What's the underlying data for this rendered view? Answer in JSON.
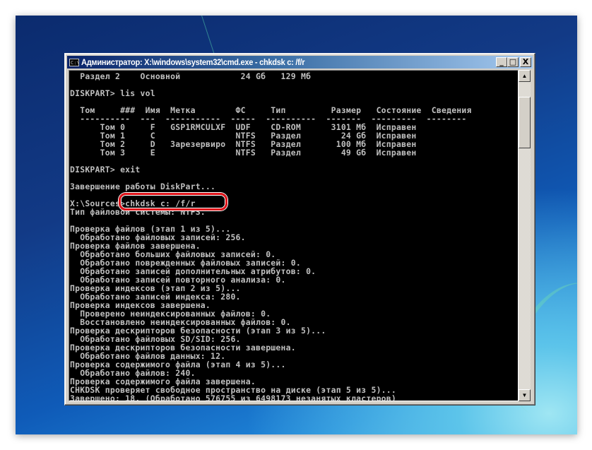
{
  "window": {
    "title": "Администратор: X:\\windows\\system32\\cmd.exe - chkdsk  c: /f/r",
    "icon": "cmd-icon",
    "icon_text": "C:\\.",
    "buttons": {
      "minimize": "_",
      "maximize": "□",
      "close": "X"
    }
  },
  "console": {
    "lines": [
      "  Раздел 2    Основной            24 Gб   129 Mб",
      "",
      "DISKPART> lis vol",
      "",
      "  Том     ###  Имя  Метка        ФС     Тип         Размер   Состояние  Сведения",
      "  ----------  ---  -----------  -----  ----------  -------  ---------  --------",
      "      Том 0     F   GSP1RMCULXF  UDF    CD-ROM      3101 Mб  Исправен",
      "      Том 1     C                NTFS   Раздел        24 Gб  Исправен",
      "      Том 2     D   Зарезервиро  NTFS   Раздел       100 Mб  Исправен",
      "      Том 3     E                NTFS   Раздел        49 Gб  Исправен",
      "",
      "DISKPART> exit",
      "",
      "Завершение работы DiskPart...",
      "",
      "X:\\Sources>chkdsk c: /f/r",
      "Тип файловой системы: NTFS.",
      "",
      "Проверка файлов (этап 1 из 5)...",
      "  Обработано файловых записей: 256.",
      "Проверка файлов завершена.",
      "  Обработано больших файловых записей: 0.",
      "  Обработано поврежденных файловых записей: 0.",
      "  Обработано записей дополнительных атрибутов: 0.",
      "  Обработано записей повторного анализа: 0.",
      "Проверка индексов (этап 2 из 5)...",
      "  Обработано записей индекса: 280.",
      "Проверка индексов завершена.",
      "  Проверено неиндексированных файлов: 0.",
      "  Восстановлено неиндексированных файлов: 0.",
      "Проверка дескрипторов безопасности (этап 3 из 5)...",
      "  Обработано файловых SD/SID: 256.",
      "Проверка дескрипторов безопасности завершена.",
      "  Обработано файлов данных: 12.",
      "Проверка содержимого файла (этап 4 из 5)...",
      "  Обработано файлов: 240.",
      "Проверка содержимого файла завершена.",
      "CHKDSK проверяет свободное пространство на диске (этап 5 из 5)...",
      "Завершено: 18. (Обработано 576755 из 6498173 незанятых кластеров)"
    ]
  },
  "scrollbar": {
    "up_arrow": "▲",
    "down_arrow": "▼"
  },
  "annotation": {
    "highlight_color": "#e0151b",
    "highlighted_text": ">chkdsk c: /f/r"
  }
}
